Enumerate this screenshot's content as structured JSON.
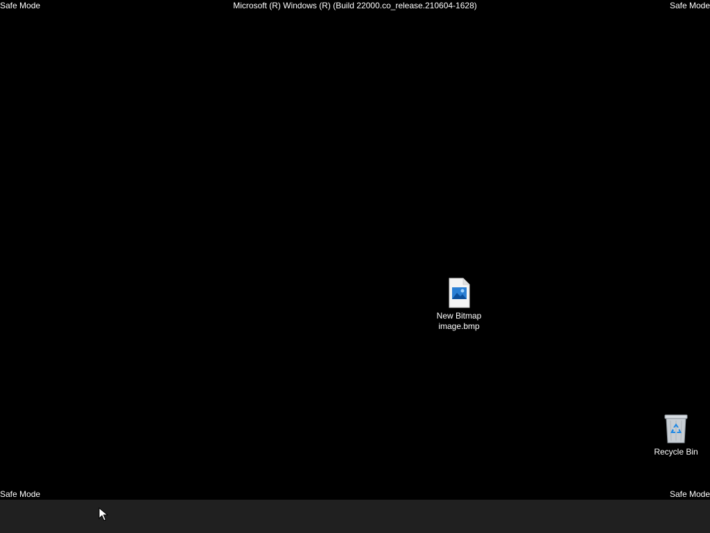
{
  "desktop": {
    "background_color": "#000000",
    "watermark": {
      "top_left": "Safe Mode",
      "top_right": "Safe Mode",
      "bottom_left": "Safe Mode",
      "bottom_right": "Safe Mode",
      "build_title": "Microsoft (R) Windows (R) (Build 22000.co_release.210604-1628)"
    },
    "icons": [
      {
        "name": "bitmap-file-icon",
        "caption_line1": "New Bitmap",
        "caption_line2": "image.bmp"
      },
      {
        "name": "recycle-bin-icon",
        "caption": "Recycle Bin"
      }
    ]
  },
  "taskbar": {
    "background_color": "#202020"
  },
  "cursor": {
    "icon": "arrow-cursor-icon"
  }
}
